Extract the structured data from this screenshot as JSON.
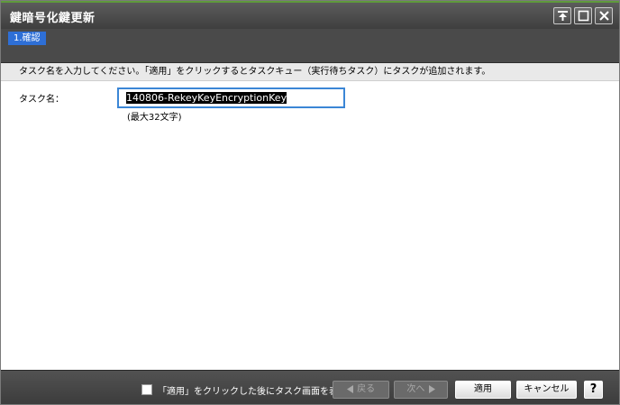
{
  "window": {
    "title": "鍵暗号化鍵更新"
  },
  "steps": [
    {
      "label": "1.確認"
    }
  ],
  "instruction": "タスク名を入力してください。「適用」をクリックするとタスクキュー（実行待ちタスク）にタスクが追加されます。",
  "form": {
    "task_name_label": "タスク名：",
    "task_name_value": "140806-RekeyKeyEncryptionKey",
    "task_name_hint": "(最大32文字)"
  },
  "footer": {
    "checkbox_label": "「適用」をクリックした後にタスク画面を表示",
    "checkbox_checked": false,
    "back_label": "戻る",
    "next_label": "次へ",
    "apply_label": "適用",
    "cancel_label": "キャンセル",
    "help_label": "?"
  },
  "icons": {
    "pin": "pin-icon",
    "maximize": "maximize-icon",
    "close": "close-icon",
    "back": "triangle-left-icon",
    "next": "triangle-right-icon"
  },
  "colors": {
    "accent": "#2e6fd6",
    "input_focus": "#3b86d6",
    "titlebar_stripe": "#5f9a3c"
  }
}
